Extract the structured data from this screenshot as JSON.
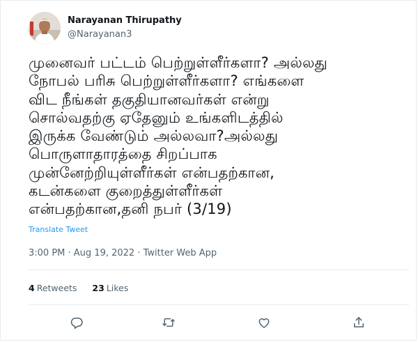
{
  "author": {
    "display_name": "Narayanan Thirupathy",
    "handle": "@Narayanan3"
  },
  "tweet": {
    "text": "முனைவர் பட்டம் பெற்றுள்ளீர்களா? அல்லது\nநோபல் பரிசு பெற்றுள்ளீர்களா? எங்களை\nவிட நீங்கள் தகுதியானவர்கள் என்று\nசொல்வதற்கு ஏதேனும் உங்களிடத்தில்\nஇருக்க வேண்டும் அல்லவா?அல்லது\nபொருளாதாரத்தை சிறப்பாக\nமுன்னேற்றியுள்ளீர்கள் என்பதற்கான,\nகடன்களை குறைத்துள்ளீர்கள்\nஎன்பதற்கான,தனி நபர் (3/19)",
    "translate_label": "Translate Tweet",
    "timestamp": "3:00 PM · Aug 19, 2022 · Twitter Web App"
  },
  "stats": {
    "retweets_count": "4",
    "retweets_label": "Retweets",
    "likes_count": "23",
    "likes_label": "Likes"
  },
  "icons": {
    "more": "more-horizontal-icon",
    "reply": "reply-icon",
    "retweet": "retweet-icon",
    "like": "heart-icon",
    "share": "share-icon"
  },
  "colors": {
    "link": "#1d9bf0",
    "secondary_text": "#536471",
    "divider": "#e6ecf0"
  }
}
